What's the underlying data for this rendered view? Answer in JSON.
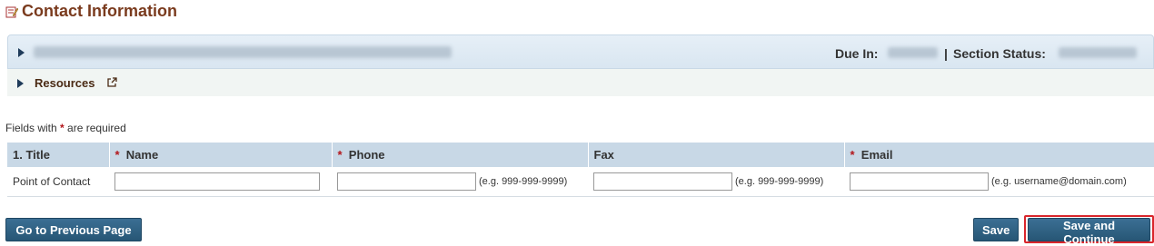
{
  "page": {
    "title": "Contact Information",
    "icon": "edit-document-icon",
    "title_color": "#7a3b1e"
  },
  "info_bar": {
    "due_label": "Due In:",
    "separator": "|",
    "status_label": "Section Status:"
  },
  "resources": {
    "label": "Resources",
    "icon": "external-link-icon"
  },
  "required_note": {
    "prefix": "Fields with",
    "star": "*",
    "suffix": "are required"
  },
  "table": {
    "columns": [
      {
        "label": "1. Title",
        "required": false
      },
      {
        "label": "Name",
        "required": true
      },
      {
        "label": "Phone",
        "required": true
      },
      {
        "label": "Fax",
        "required": false
      },
      {
        "label": "Email",
        "required": true
      }
    ],
    "row": {
      "title": "Point of Contact",
      "name_value": "",
      "phone_value": "",
      "phone_hint": "(e.g. 999-999-9999)",
      "fax_value": "",
      "fax_hint": "(e.g. 999-999-9999)",
      "email_value": "",
      "email_hint": "(e.g. username@domain.com)"
    }
  },
  "buttons": {
    "previous": "Go to Previous Page",
    "save": "Save",
    "save_continue": "Save and Continue"
  },
  "colors": {
    "button_bg": "#275675",
    "header_bg": "#c8d8e6",
    "required_star": "#b3161b",
    "highlight_border": "#d9262c"
  }
}
